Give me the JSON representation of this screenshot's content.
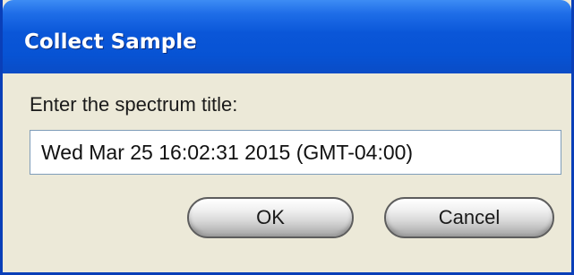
{
  "window": {
    "title": "Collect Sample"
  },
  "form": {
    "prompt_label": "Enter the spectrum title:",
    "spectrum_title_value": "Wed Mar 25 16:02:31 2015 (GMT-04:00)"
  },
  "buttons": {
    "ok_label": "OK",
    "cancel_label": "Cancel"
  },
  "colors": {
    "titlebar": "#0a56d8",
    "dialog_background": "#ece9d8",
    "title_text": "#ffffff"
  }
}
